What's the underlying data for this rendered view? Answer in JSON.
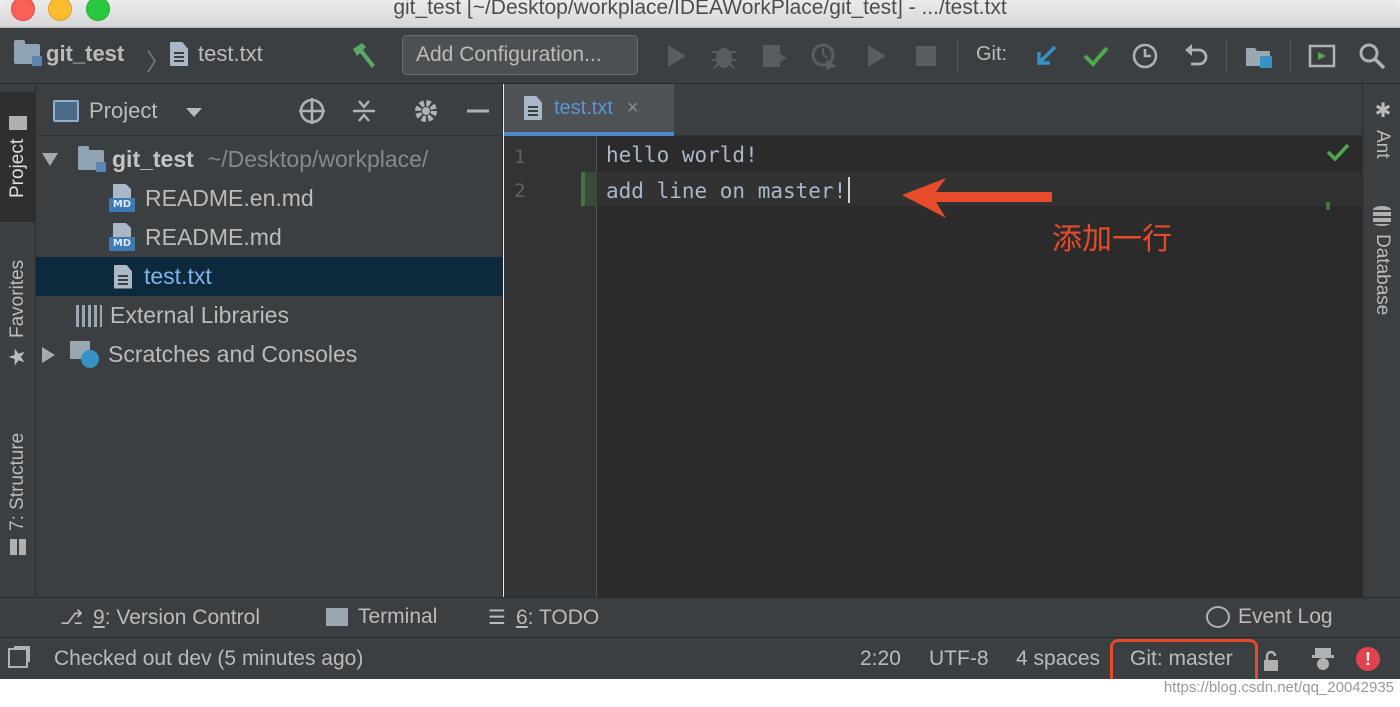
{
  "window": {
    "title": "git_test [~/Desktop/workplace/IDEAWorkPlace/git_test] - .../test.txt"
  },
  "navbar": {
    "project_name": "git_test",
    "file_name": "test.txt",
    "add_configuration": "Add Configuration...",
    "git_label": "Git:"
  },
  "left_stripe": {
    "project": "Project",
    "favorites": "Favorites",
    "structure": "7: Structure"
  },
  "project_panel": {
    "title": "Project",
    "root_name": "git_test",
    "root_path": "~/Desktop/workplace/",
    "files": [
      "README.en.md",
      "README.md",
      "test.txt"
    ],
    "external_libraries": "External Libraries",
    "scratches": "Scratches and Consoles",
    "md_badge": "MD"
  },
  "editor": {
    "tab_label": "test.txt",
    "close_glyph": "×",
    "line_numbers": [
      "1",
      "2"
    ],
    "lines": [
      "hello world!",
      "add line on master!"
    ],
    "annotation": "添加一行"
  },
  "right_stripe": {
    "ant": "Ant",
    "database": "Database"
  },
  "bottom_tools": {
    "version_control_num": "9",
    "version_control": ": Version Control",
    "terminal": "Terminal",
    "todo_num": "6",
    "todo": ": TODO",
    "event_log": "Event Log"
  },
  "status": {
    "message": "Checked out dev (5 minutes ago)",
    "position": "2:20",
    "encoding": "UTF-8",
    "indent": "4 spaces",
    "git_branch": "Git: master"
  },
  "watermark": "https://blog.csdn.net/qq_20042935",
  "colors": {
    "accent_blue": "#4a88c7",
    "annotation_red": "#e84b2c",
    "vcs_green": "#4fa74f"
  }
}
